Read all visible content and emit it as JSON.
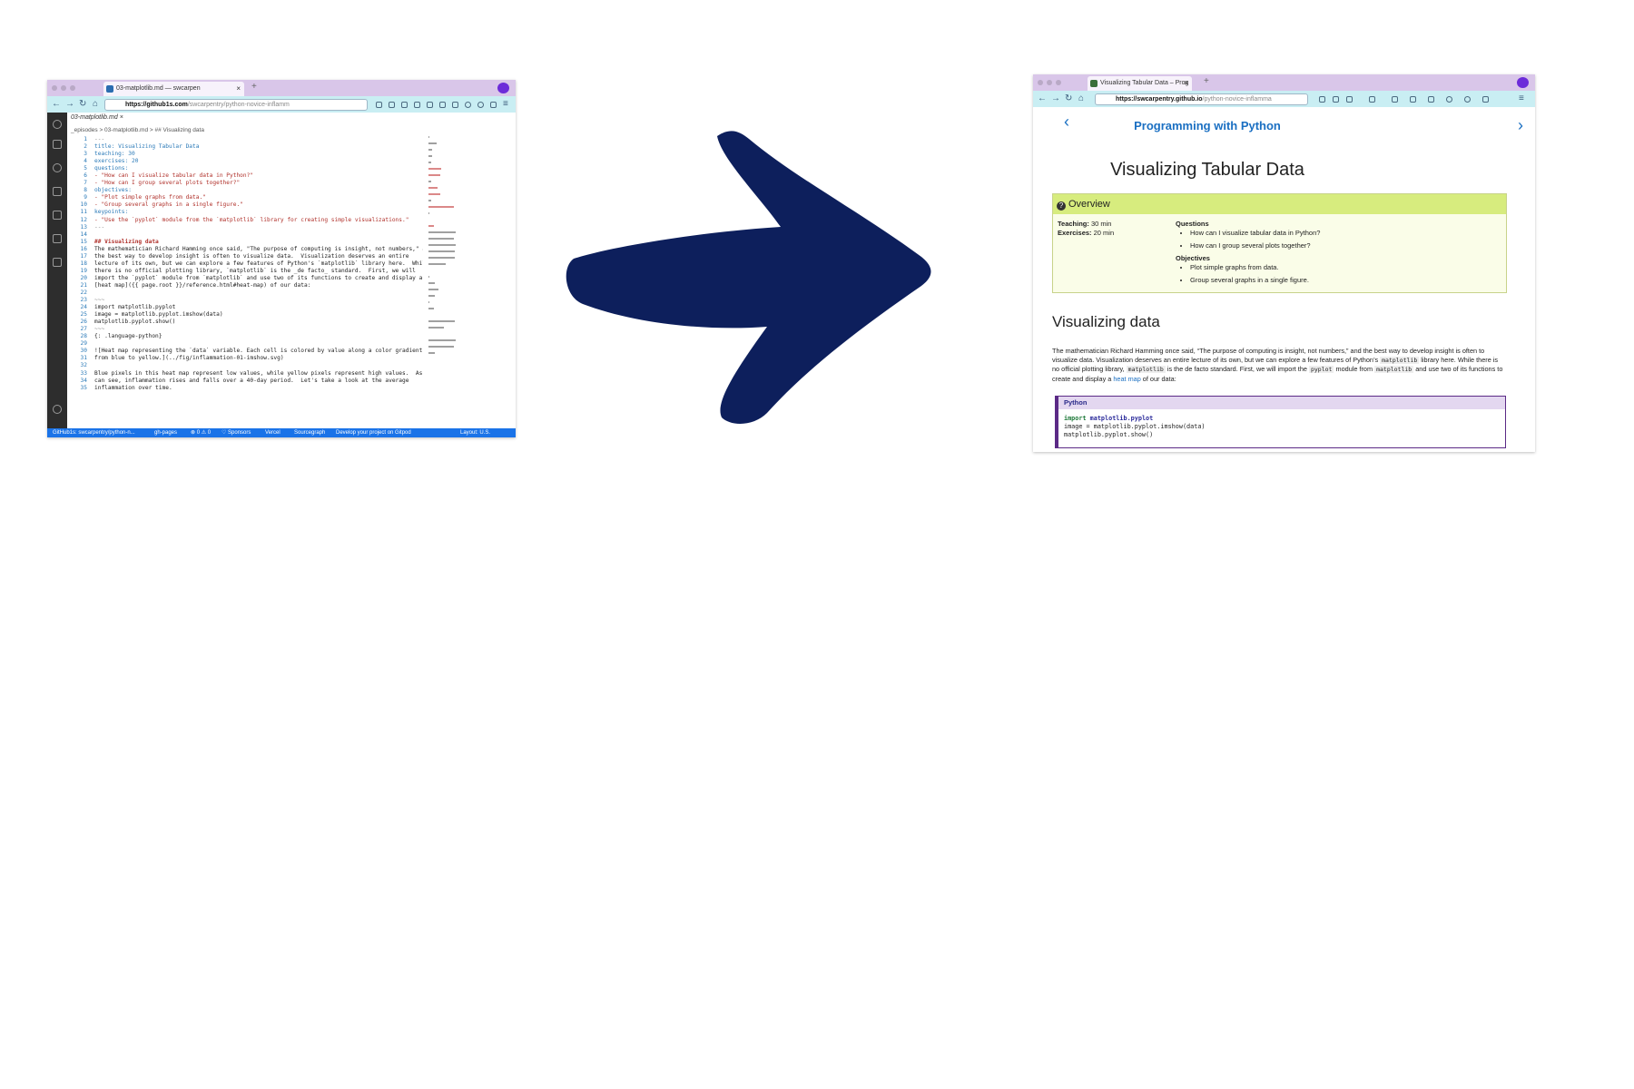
{
  "editor_window": {
    "tab_title": "03-matplotlib.md — swcarpen",
    "url_host": "https://github1s.com",
    "url_path": "/swcarpentry/python-novice-inflamm",
    "editor_tab": "03-matplotlib.md",
    "breadcrumb": "_episodes > 03-matplotlib.md > ## Visualizing data",
    "code_lines": [
      {
        "n": "1",
        "t": "---",
        "c": "c-dim"
      },
      {
        "n": "2",
        "t": "title: Visualizing Tabular Data",
        "c": "c-key"
      },
      {
        "n": "3",
        "t": "teaching: 30",
        "c": "c-key"
      },
      {
        "n": "4",
        "t": "exercises: 20",
        "c": "c-key"
      },
      {
        "n": "5",
        "t": "questions:",
        "c": "c-key"
      },
      {
        "n": "6",
        "t": "- \"How can I visualize tabular data in Python?\"",
        "c": "c-str"
      },
      {
        "n": "7",
        "t": "- \"How can I group several plots together?\"",
        "c": "c-str"
      },
      {
        "n": "8",
        "t": "objectives:",
        "c": "c-key"
      },
      {
        "n": "9",
        "t": "- \"Plot simple graphs from data.\"",
        "c": "c-str"
      },
      {
        "n": "10",
        "t": "- \"Group several graphs in a single figure.\"",
        "c": "c-str"
      },
      {
        "n": "11",
        "t": "keypoints:",
        "c": "c-key"
      },
      {
        "n": "12",
        "t": "- \"Use the `pyplot` module from the `matplotlib` library for creating simple visualizations.\"",
        "c": "c-str"
      },
      {
        "n": "13",
        "t": "---",
        "c": "c-dim"
      },
      {
        "n": "14",
        "t": "",
        "c": "c-plain"
      },
      {
        "n": "15",
        "t": "## Visualizing data",
        "c": "c-head"
      },
      {
        "n": "16",
        "t": "The mathematician Richard Hamming once said, \"The purpose of computing is insight, not numbers,\" and",
        "c": "c-plain"
      },
      {
        "n": "17",
        "t": "the best way to develop insight is often to visualize data.  Visualization deserves an entire",
        "c": "c-plain"
      },
      {
        "n": "18",
        "t": "lecture of its own, but we can explore a few features of Python's `matplotlib` library here.  While",
        "c": "c-plain"
      },
      {
        "n": "19",
        "t": "there is no official plotting library, `matplotlib` is the _de facto_ standard.  First, we will",
        "c": "c-plain"
      },
      {
        "n": "20",
        "t": "import the `pyplot` module from `matplotlib` and use two of its functions to create and display a",
        "c": "c-plain"
      },
      {
        "n": "21",
        "t": "[heat map]({{ page.root }}/reference.html#heat-map) of our data:",
        "c": "c-plain"
      },
      {
        "n": "22",
        "t": "",
        "c": "c-plain"
      },
      {
        "n": "23",
        "t": "~~~",
        "c": "c-dim"
      },
      {
        "n": "24",
        "t": "import matplotlib.pyplot",
        "c": "c-plain"
      },
      {
        "n": "25",
        "t": "image = matplotlib.pyplot.imshow(data)",
        "c": "c-plain"
      },
      {
        "n": "26",
        "t": "matplotlib.pyplot.show()",
        "c": "c-plain"
      },
      {
        "n": "27",
        "t": "~~~",
        "c": "c-dim"
      },
      {
        "n": "28",
        "t": "{: .language-python}",
        "c": "c-plain"
      },
      {
        "n": "29",
        "t": "",
        "c": "c-plain"
      },
      {
        "n": "30",
        "t": "![Heat map representing the `data` variable. Each cell is colored by value along a color gradient",
        "c": "c-plain"
      },
      {
        "n": "31",
        "t": "from blue to yellow.](../fig/inflammation-01-imshow.svg)",
        "c": "c-plain"
      },
      {
        "n": "32",
        "t": "",
        "c": "c-plain"
      },
      {
        "n": "33",
        "t": "Blue pixels in this heat map represent low values, while yellow pixels represent high values.  As we",
        "c": "c-plain"
      },
      {
        "n": "34",
        "t": "can see, inflammation rises and falls over a 40-day period.  Let's take a look at the average",
        "c": "c-plain"
      },
      {
        "n": "35",
        "t": "inflammation over time.",
        "c": "c-plain"
      }
    ],
    "status_items": [
      "GitHub1s: swcarpentry/python-n...",
      "gh-pages",
      "⊗ 0 ⚠ 0",
      "♡ Sponsors",
      "Vercel",
      "Sourcegraph",
      "Develop your project on Gitpod",
      "Layout: U.S."
    ]
  },
  "page_window": {
    "tab_title": "Visualizing Tabular Data – Prog",
    "url_host": "https://swcarpentry.github.io",
    "url_path": "/python-novice-inflamma",
    "site_title": "Programming with Python",
    "prev_glyph": "‹",
    "next_glyph": "›",
    "heading": "Visualizing Tabular Data",
    "overview": {
      "title": "Overview",
      "teaching_label": "Teaching:",
      "teaching_value": "30 min",
      "exercises_label": "Exercises:",
      "exercises_value": "20 min",
      "questions_label": "Questions",
      "questions": [
        "How can I visualize tabular data in Python?",
        "How can I group several plots together?"
      ],
      "objectives_label": "Objectives",
      "objectives": [
        "Plot simple graphs from data.",
        "Group several graphs in a single figure."
      ]
    },
    "section_heading": "Visualizing data",
    "paragraph": {
      "p1": "The mathematician Richard Hamming once said, “The purpose of computing is insight, not numbers,” and the best way to develop insight is often to visualize data. Visualization deserves an entire lecture of its own, but we can explore a few features of Python’s ",
      "c1": "matplotlib",
      "p2": " library here. While there is no official plotting library, ",
      "c2": "matplotlib",
      "p3": " is the de facto standard. First, we will import the ",
      "c3": "pyplot",
      "p4": " module from ",
      "c4": "matplotlib",
      "p5": " and use two of its functions to create and display a ",
      "link": "heat map",
      "p6": " of our data:"
    },
    "code_box": {
      "label": "Python",
      "line1_kw": "import",
      "line1_mod": "matplotlib.pyplot",
      "line2": "image = matplotlib.pyplot.imshow(data)",
      "line3": "matplotlib.pyplot.show()"
    }
  },
  "colors": {
    "arrow": "#0d1f5c",
    "tabbar": "#d9c6e9",
    "navbar": "#c9eef3",
    "status_bar": "#1a73e8",
    "overview_header": "#d7ec7e",
    "link": "#1a6fc2"
  }
}
